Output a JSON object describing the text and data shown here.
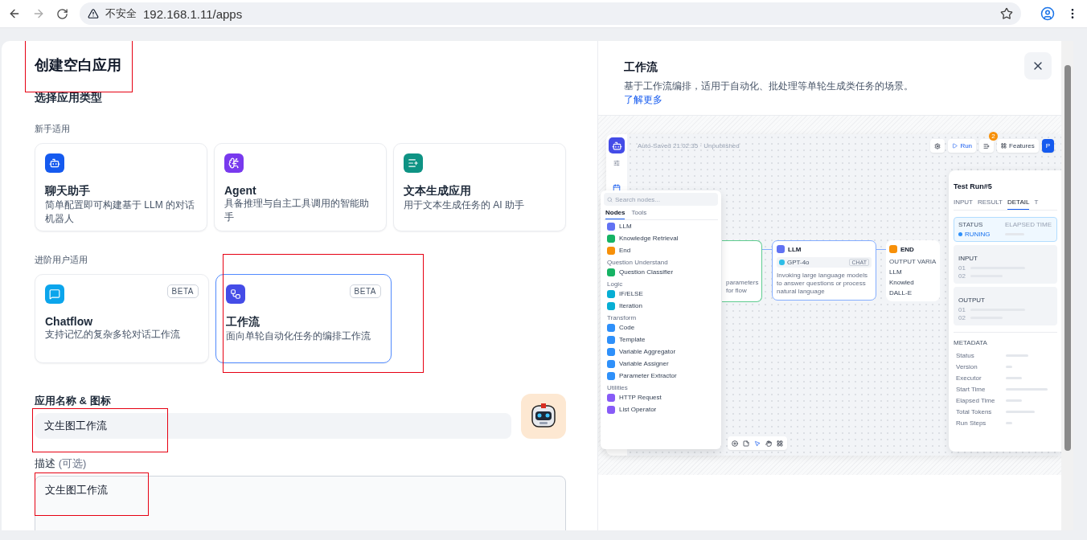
{
  "browser": {
    "security": "不安全",
    "url": "192.168.1.11/apps"
  },
  "dialog": {
    "title": "创建空白应用",
    "title_annotated": true,
    "type_heading": "选择应用类型",
    "groups": [
      {
        "label": "新手适用",
        "cards": [
          {
            "kind": "assistant",
            "color": "#155aef",
            "title": "聊天助手",
            "description": "简单配置即可构建基于 LLM 的对话机器人",
            "selected": false,
            "annotated": false
          },
          {
            "kind": "agent",
            "color": "#7839ee",
            "title": "Agent",
            "description": "具备推理与自主工具调用的智能助手",
            "selected": false,
            "annotated": false
          },
          {
            "kind": "text",
            "color": "#0e9384",
            "title": "文本生成应用",
            "description": "用于文本生成任务的 AI 助手",
            "selected": false,
            "annotated": false
          }
        ]
      },
      {
        "label": "进阶用户适用",
        "cards": [
          {
            "kind": "chatflow",
            "color": "#0ba5ec",
            "title": "Chatflow",
            "description": "支持记忆的复杂多轮对话工作流",
            "badge": "BETA",
            "selected": false,
            "annotated": false
          },
          {
            "kind": "workflow",
            "color": "#444ce7",
            "title": "工作流",
            "description": "面向单轮自动化任务的编排工作流",
            "badge": "BETA",
            "selected": true,
            "annotated": true
          }
        ]
      }
    ],
    "name_field": {
      "label": "应用名称 & 图标",
      "value": "文生图工作流",
      "annotated": true
    },
    "description_field": {
      "label": "描述",
      "hint": "(可选)",
      "value": "文生图工作流",
      "annotated": true
    }
  },
  "preview": {
    "title": "工作流",
    "description": "基于工作流编排，适用于自动化、批处理等单轮生成类任务的场景。",
    "link": "了解更多",
    "app": {
      "autosave": "Auto-Saved 21:02:35 · Unpublished",
      "run": "Run",
      "badge": "2",
      "features": "Features",
      "publish": "P",
      "node_menu": {
        "placeholder": "Search nodes...",
        "tabs": [
          {
            "label": "Nodes",
            "selected": true
          },
          {
            "label": "Tools",
            "selected": false
          }
        ],
        "sections": [
          {
            "items": [
              {
                "label": "LLM",
                "color": "#6172f3"
              },
              {
                "label": "Knowledge Retrieval",
                "color": "#16b364"
              },
              {
                "label": "End",
                "color": "#f79009"
              }
            ]
          },
          {
            "heading": "Question Understand",
            "items": [
              {
                "label": "Question Classifier",
                "color": "#16b364"
              }
            ]
          },
          {
            "heading": "Logic",
            "items": [
              {
                "label": "IF/ELSE",
                "color": "#06aed4"
              },
              {
                "label": "Iteration",
                "color": "#06aed4"
              }
            ]
          },
          {
            "heading": "Transform",
            "items": [
              {
                "label": "Code",
                "color": "#2e90fa"
              },
              {
                "label": "Template",
                "color": "#2e90fa"
              },
              {
                "label": "Variable Aggregator",
                "color": "#2e90fa"
              },
              {
                "label": "Variable Assigner",
                "color": "#2e90fa"
              },
              {
                "label": "Parameter Extractor",
                "color": "#2e90fa"
              }
            ]
          },
          {
            "heading": "Utilities",
            "items": [
              {
                "label": "HTTP Request",
                "color": "#875bf7"
              },
              {
                "label": "List Operator",
                "color": "#875bf7"
              }
            ]
          }
        ]
      },
      "start_node": {
        "description": "parameters for flow"
      },
      "llm_node": {
        "title": "LLM",
        "model": "GPT-4o",
        "tag": "CHAT",
        "description": "Invoking large language models to answer questions or process natural language"
      },
      "end_node": {
        "title": "END",
        "label": "OUTPUT VARIA",
        "outputs": [
          "LLM",
          "Knowled",
          "DALL-E"
        ]
      },
      "test_run": {
        "title": "Test Run#5",
        "tabs": [
          {
            "label": "INPUT",
            "selected": false
          },
          {
            "label": "RESULT",
            "selected": false
          },
          {
            "label": "DETAIL",
            "selected": true
          },
          {
            "label": "T",
            "selected": false
          }
        ],
        "status_label": "STATUS",
        "status": "RUNING",
        "elapsed_label": "ELAPSED TIME",
        "sections": [
          {
            "title": "INPUT",
            "rows": [
              "01",
              "02"
            ]
          },
          {
            "title": "OUTPUT",
            "rows": [
              "01",
              "02"
            ]
          }
        ],
        "metadata_title": "METADATA",
        "metadata": [
          "Status",
          "Version",
          "Executor",
          "Start Time",
          "Elapsed Time",
          "Total Tokens",
          "Run Steps"
        ]
      }
    }
  }
}
